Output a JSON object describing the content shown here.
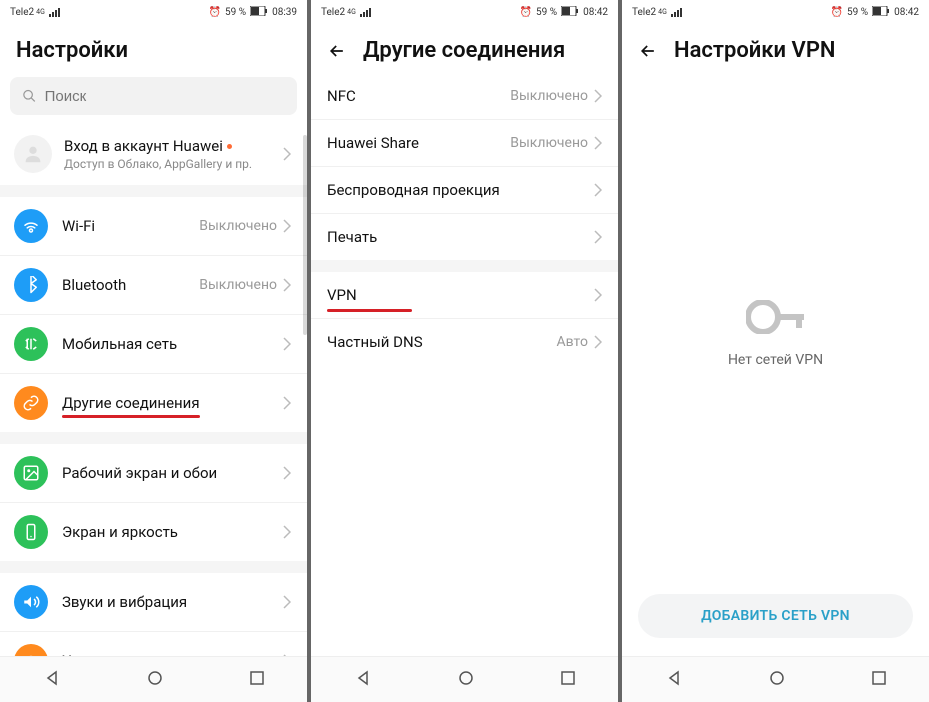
{
  "screens": {
    "settings": {
      "statusbar": {
        "carrier": "Tele2",
        "net": "4G",
        "battery_text": "59 %",
        "time": "08:39"
      },
      "title": "Настройки",
      "search_placeholder": "Поиск",
      "account": {
        "title": "Вход в аккаунт Huawei",
        "subtitle": "Доступ в Облако, AppGallery и пр."
      },
      "group1": [
        {
          "label": "Wi-Fi",
          "value": "Выключено",
          "color": "#1e9df7",
          "icon": "wifi"
        },
        {
          "label": "Bluetooth",
          "value": "Выключено",
          "color": "#1e9df7",
          "icon": "bluetooth"
        },
        {
          "label": "Мобильная сеть",
          "value": "",
          "color": "#2dc15a",
          "icon": "cellular"
        },
        {
          "label": "Другие соединения",
          "value": "",
          "color": "#ff8a1e",
          "icon": "link",
          "underline": true
        }
      ],
      "group2": [
        {
          "label": "Рабочий экран и обои",
          "value": "",
          "color": "#2dc15a",
          "icon": "picture"
        },
        {
          "label": "Экран и яркость",
          "value": "",
          "color": "#2dc15a",
          "icon": "phone"
        }
      ],
      "group3": [
        {
          "label": "Звуки и вибрация",
          "value": "",
          "color": "#1e9df7",
          "icon": "sound"
        },
        {
          "label": "Уведомления",
          "value": "",
          "color": "#ff8a1e",
          "icon": "bell"
        }
      ]
    },
    "other_conn": {
      "statusbar": {
        "carrier": "Tele2",
        "net": "4G",
        "battery_text": "59 %",
        "time": "08:42"
      },
      "title": "Другие соединения",
      "group1": [
        {
          "label": "NFC",
          "value": "Выключено"
        },
        {
          "label": "Huawei Share",
          "value": "Выключено"
        },
        {
          "label": "Беспроводная проекция",
          "value": ""
        },
        {
          "label": "Печать",
          "value": ""
        }
      ],
      "group2": [
        {
          "label": "VPN",
          "value": "",
          "underline": true
        },
        {
          "label": "Частный DNS",
          "value": "Авто"
        }
      ]
    },
    "vpn": {
      "statusbar": {
        "carrier": "Tele2",
        "net": "4G",
        "battery_text": "59 %",
        "time": "08:42"
      },
      "title": "Настройки VPN",
      "empty_text": "Нет сетей VPN",
      "add_button": "ДОБАВИТЬ СЕТЬ VPN"
    }
  }
}
